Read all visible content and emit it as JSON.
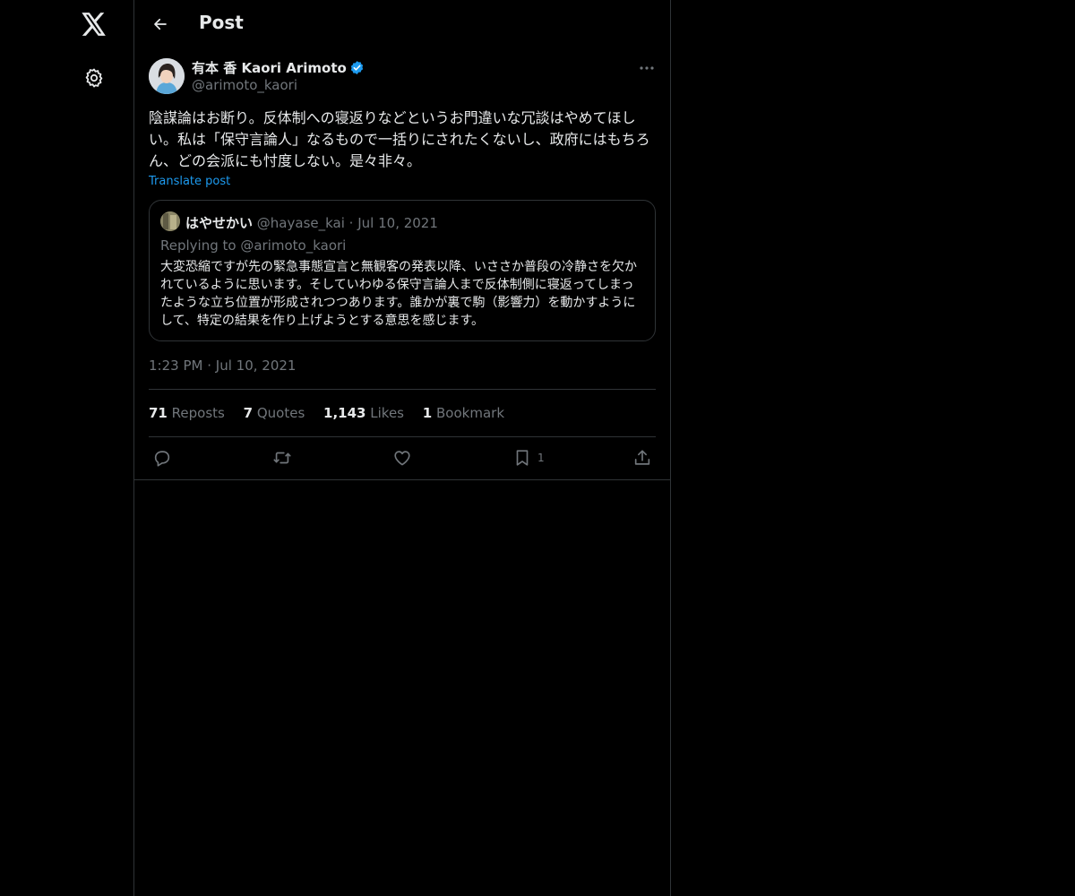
{
  "header": {
    "title": "Post"
  },
  "author": {
    "name": "有本 香 Kaori Arimoto",
    "handle": "@arimoto_kaori"
  },
  "post": {
    "text": "陰謀論はお断り。反体制への寝返りなどというお門違いな冗談はやめてほしい。私は「保守言論人」なるもので一括りにされたくないし、政府にはもちろん、どの会派にも忖度しない。是々非々。",
    "translate_label": "Translate post",
    "time": "1:23 PM",
    "date": "Jul 10, 2021"
  },
  "quote": {
    "name": "はやせかい",
    "handle": "@hayase_kai",
    "date": "Jul 10, 2021",
    "replying_to": "Replying to @arimoto_kaori",
    "text": "大変恐縮ですが先の緊急事態宣言と無観客の発表以降、いささか普段の冷静さを欠かれているように思います。そしていわゆる保守言論人まで反体制側に寝返ってしまったような立ち位置が形成されつつあります。誰かが裏で駒（影響力）を動かすようにして、特定の結果を作り上げようとする意思を感じます。"
  },
  "stats": {
    "reposts_count": "71",
    "reposts_label": "Reposts",
    "quotes_count": "7",
    "quotes_label": "Quotes",
    "likes_count": "1,143",
    "likes_label": "Likes",
    "bookmarks_count": "1",
    "bookmarks_label": "Bookmark"
  },
  "actions": {
    "bookmark_count": "1"
  },
  "icons": {
    "nav": [
      "x-logo-icon",
      "gear-icon"
    ],
    "header": [
      "back-arrow-icon"
    ],
    "post": [
      "verified-badge-icon",
      "more-icon"
    ],
    "actions": [
      "reply-icon",
      "repost-icon",
      "like-icon",
      "bookmark-icon",
      "share-icon"
    ]
  },
  "colors": {
    "background": "#000000",
    "text": "#e7e9ea",
    "muted": "#71767b",
    "accent": "#1d9bf0",
    "border": "#2f3336"
  }
}
